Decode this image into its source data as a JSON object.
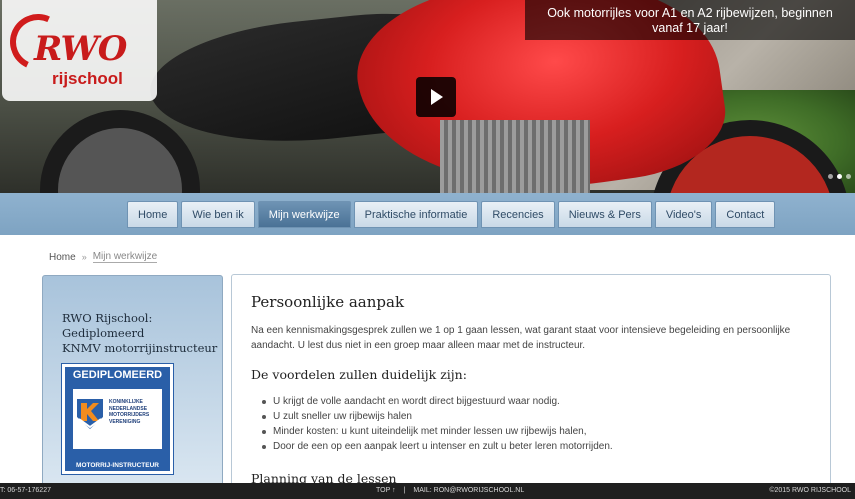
{
  "hero": {
    "caption": "Ook motorrijles voor A1 en A2 rijbewijzen, beginnen vanaf 17 jaar!",
    "logo_main": "RWO",
    "logo_sub": "rijschool"
  },
  "nav": {
    "items": [
      {
        "label": "Home"
      },
      {
        "label": "Wie ben ik"
      },
      {
        "label": "Mijn werkwijze",
        "active": true
      },
      {
        "label": "Praktische informatie"
      },
      {
        "label": "Recencies"
      },
      {
        "label": "Nieuws & Pers"
      },
      {
        "label": "Video's"
      },
      {
        "label": "Contact"
      }
    ]
  },
  "breadcrumb": {
    "home": "Home",
    "sep": "»",
    "current": "Mijn werkwijze"
  },
  "sidebar": {
    "line1": "RWO Rijschool:",
    "line2": "Gediplomeerd",
    "line3": "KNMV motorrijinstructeur",
    "badge_top": "GEDIPLOMEERD",
    "badge_org": [
      "KONINKLIJKE",
      "NEDERLANDSE",
      "MOTORRIJDERS",
      "VERENIGING"
    ],
    "badge_bottom": "MOTORRIJ-INSTRUCTEUR"
  },
  "content": {
    "title": "Persoonlijke aanpak",
    "intro": "Na een kennismakingsgesprek zullen we 1 op 1 gaan lessen, wat garant staat voor intensieve begeleiding en persoonlijke aandacht. U lest dus niet in een groep maar alleen maar met de instructeur.",
    "benefits_title": "De voordelen zullen duidelijk zijn:",
    "benefits": [
      "U krijgt de volle aandacht en wordt direct bijgestuurd waar nodig.",
      "U zult sneller uw rijbewijs halen",
      "Minder kosten: u kunt uiteindelijk met minder lessen uw rijbewijs halen,",
      "Door de een op een aanpak leert u intenser en zult u beter leren motorrijden."
    ],
    "next_title": "Planning van de lessen"
  },
  "footer": {
    "phone": "T: 06-57-176227",
    "top": "TOP ↑",
    "sep": "|",
    "mail": "MAIL: RON@RWORIJSCHOOL.NL",
    "copyright": "©2015 RWO RIJSCHOOL"
  },
  "colors": {
    "accent": "#c81b1b",
    "nav_bar": "#8fb2cf",
    "nav_active": "#4a7296",
    "footer": "#1f1f1f"
  }
}
